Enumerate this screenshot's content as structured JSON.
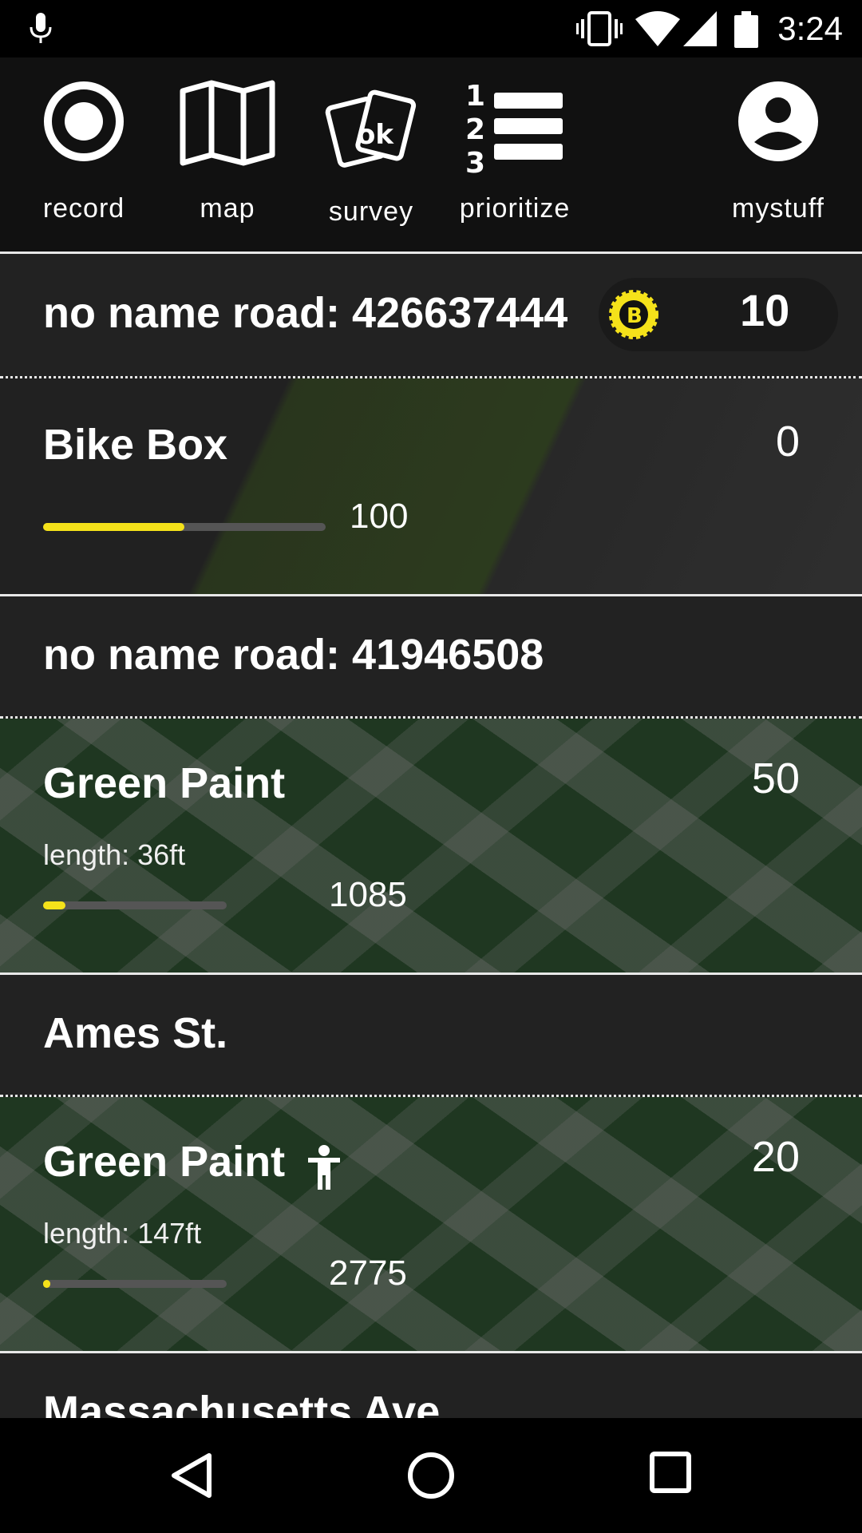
{
  "status_bar": {
    "time": "3:24",
    "icons": [
      "mic-icon",
      "vibrate-icon",
      "wifi-icon",
      "signal-icon",
      "battery-icon"
    ]
  },
  "top_nav": {
    "items": [
      {
        "label": "record",
        "icon": "record-icon"
      },
      {
        "label": "map",
        "icon": "map-icon"
      },
      {
        "label": "survey",
        "icon": "survey-cards-icon"
      },
      {
        "label": "prioritize",
        "icon": "numbered-list-icon"
      },
      {
        "label": "mystuff",
        "icon": "account-icon"
      }
    ]
  },
  "list": {
    "road1": {
      "title": "no name road: 426637444",
      "badge_icon": "bike-badge-icon",
      "score": "10"
    },
    "bike_box": {
      "title": "Bike Box",
      "value": "0",
      "bar_number": "100",
      "bar_fill": 0.5
    },
    "road2": {
      "title": "no name road: 41946508"
    },
    "green_paint_1": {
      "title": "Green Paint",
      "value": "50",
      "length": "length: 36ft",
      "bar_number": "1085",
      "bar_fill": 0.12
    },
    "road3": {
      "title": "Ames St."
    },
    "green_paint_2": {
      "title": "Green Paint",
      "icon": "pedestrian-icon",
      "value": "20",
      "length": "length: 147ft",
      "bar_number": "2775",
      "bar_fill": 0.04
    },
    "road4": {
      "title": "Massachusetts Ave"
    }
  },
  "colors": {
    "accent": "#f5e21a",
    "background": "#222222",
    "nav_background": "#111111"
  }
}
